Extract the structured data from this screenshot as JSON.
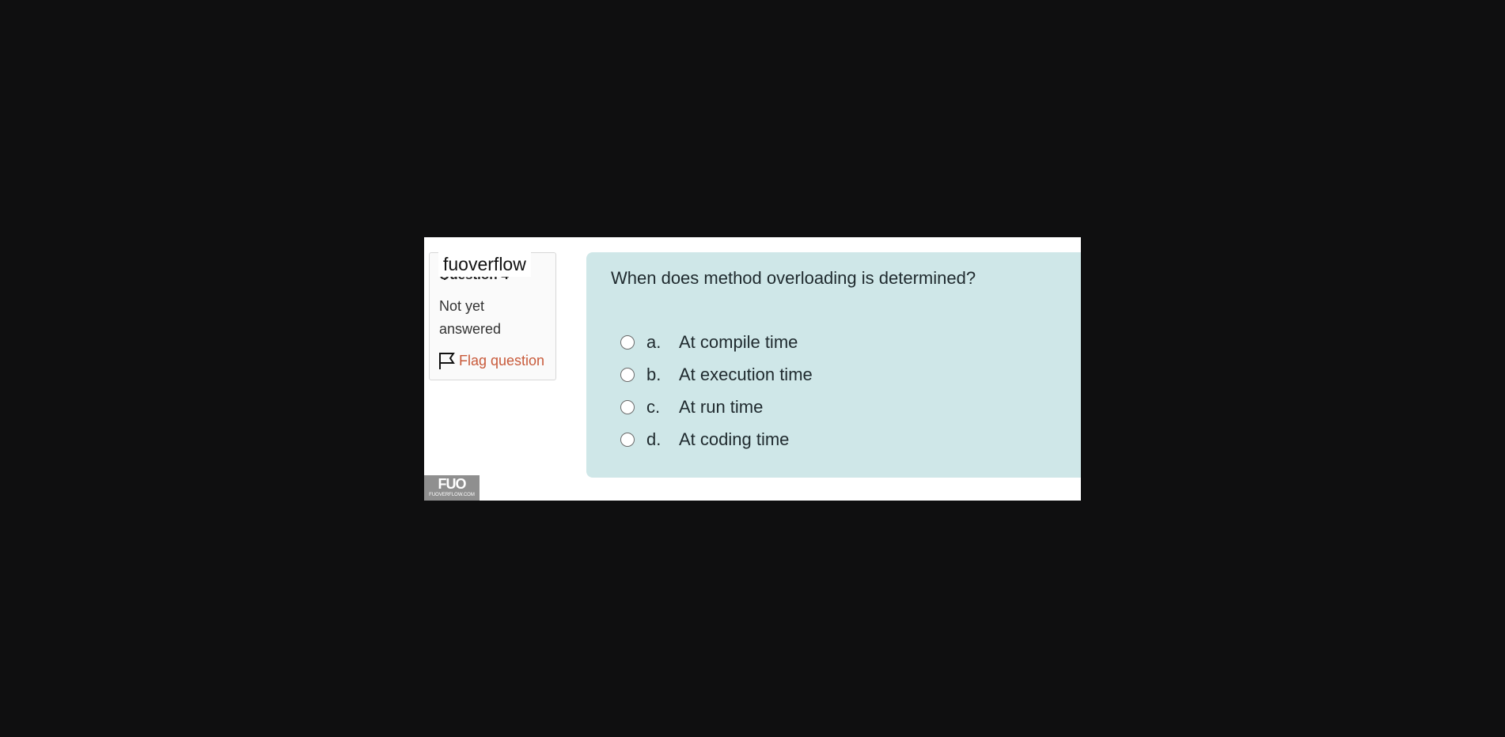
{
  "sidebar": {
    "question_label": "Question 4",
    "status_text": "Not yet answered",
    "flag_label": "Flag question",
    "watermark": "fuoverflow"
  },
  "question": {
    "text": "When does method overloading is determined?",
    "options": [
      {
        "letter": "a.",
        "text": "At compile time"
      },
      {
        "letter": "b.",
        "text": "At execution time"
      },
      {
        "letter": "c.",
        "text": "At run time"
      },
      {
        "letter": "d.",
        "text": "At coding time"
      }
    ]
  },
  "logo": {
    "main": "FUO",
    "sub": "FUOVERFLOW.COM"
  },
  "icons": [
    "flag-icon",
    "radio-icon"
  ],
  "colors": {
    "background": "#0f0f10",
    "panel": "#cfe7e8",
    "flag": "#c85a3a"
  }
}
